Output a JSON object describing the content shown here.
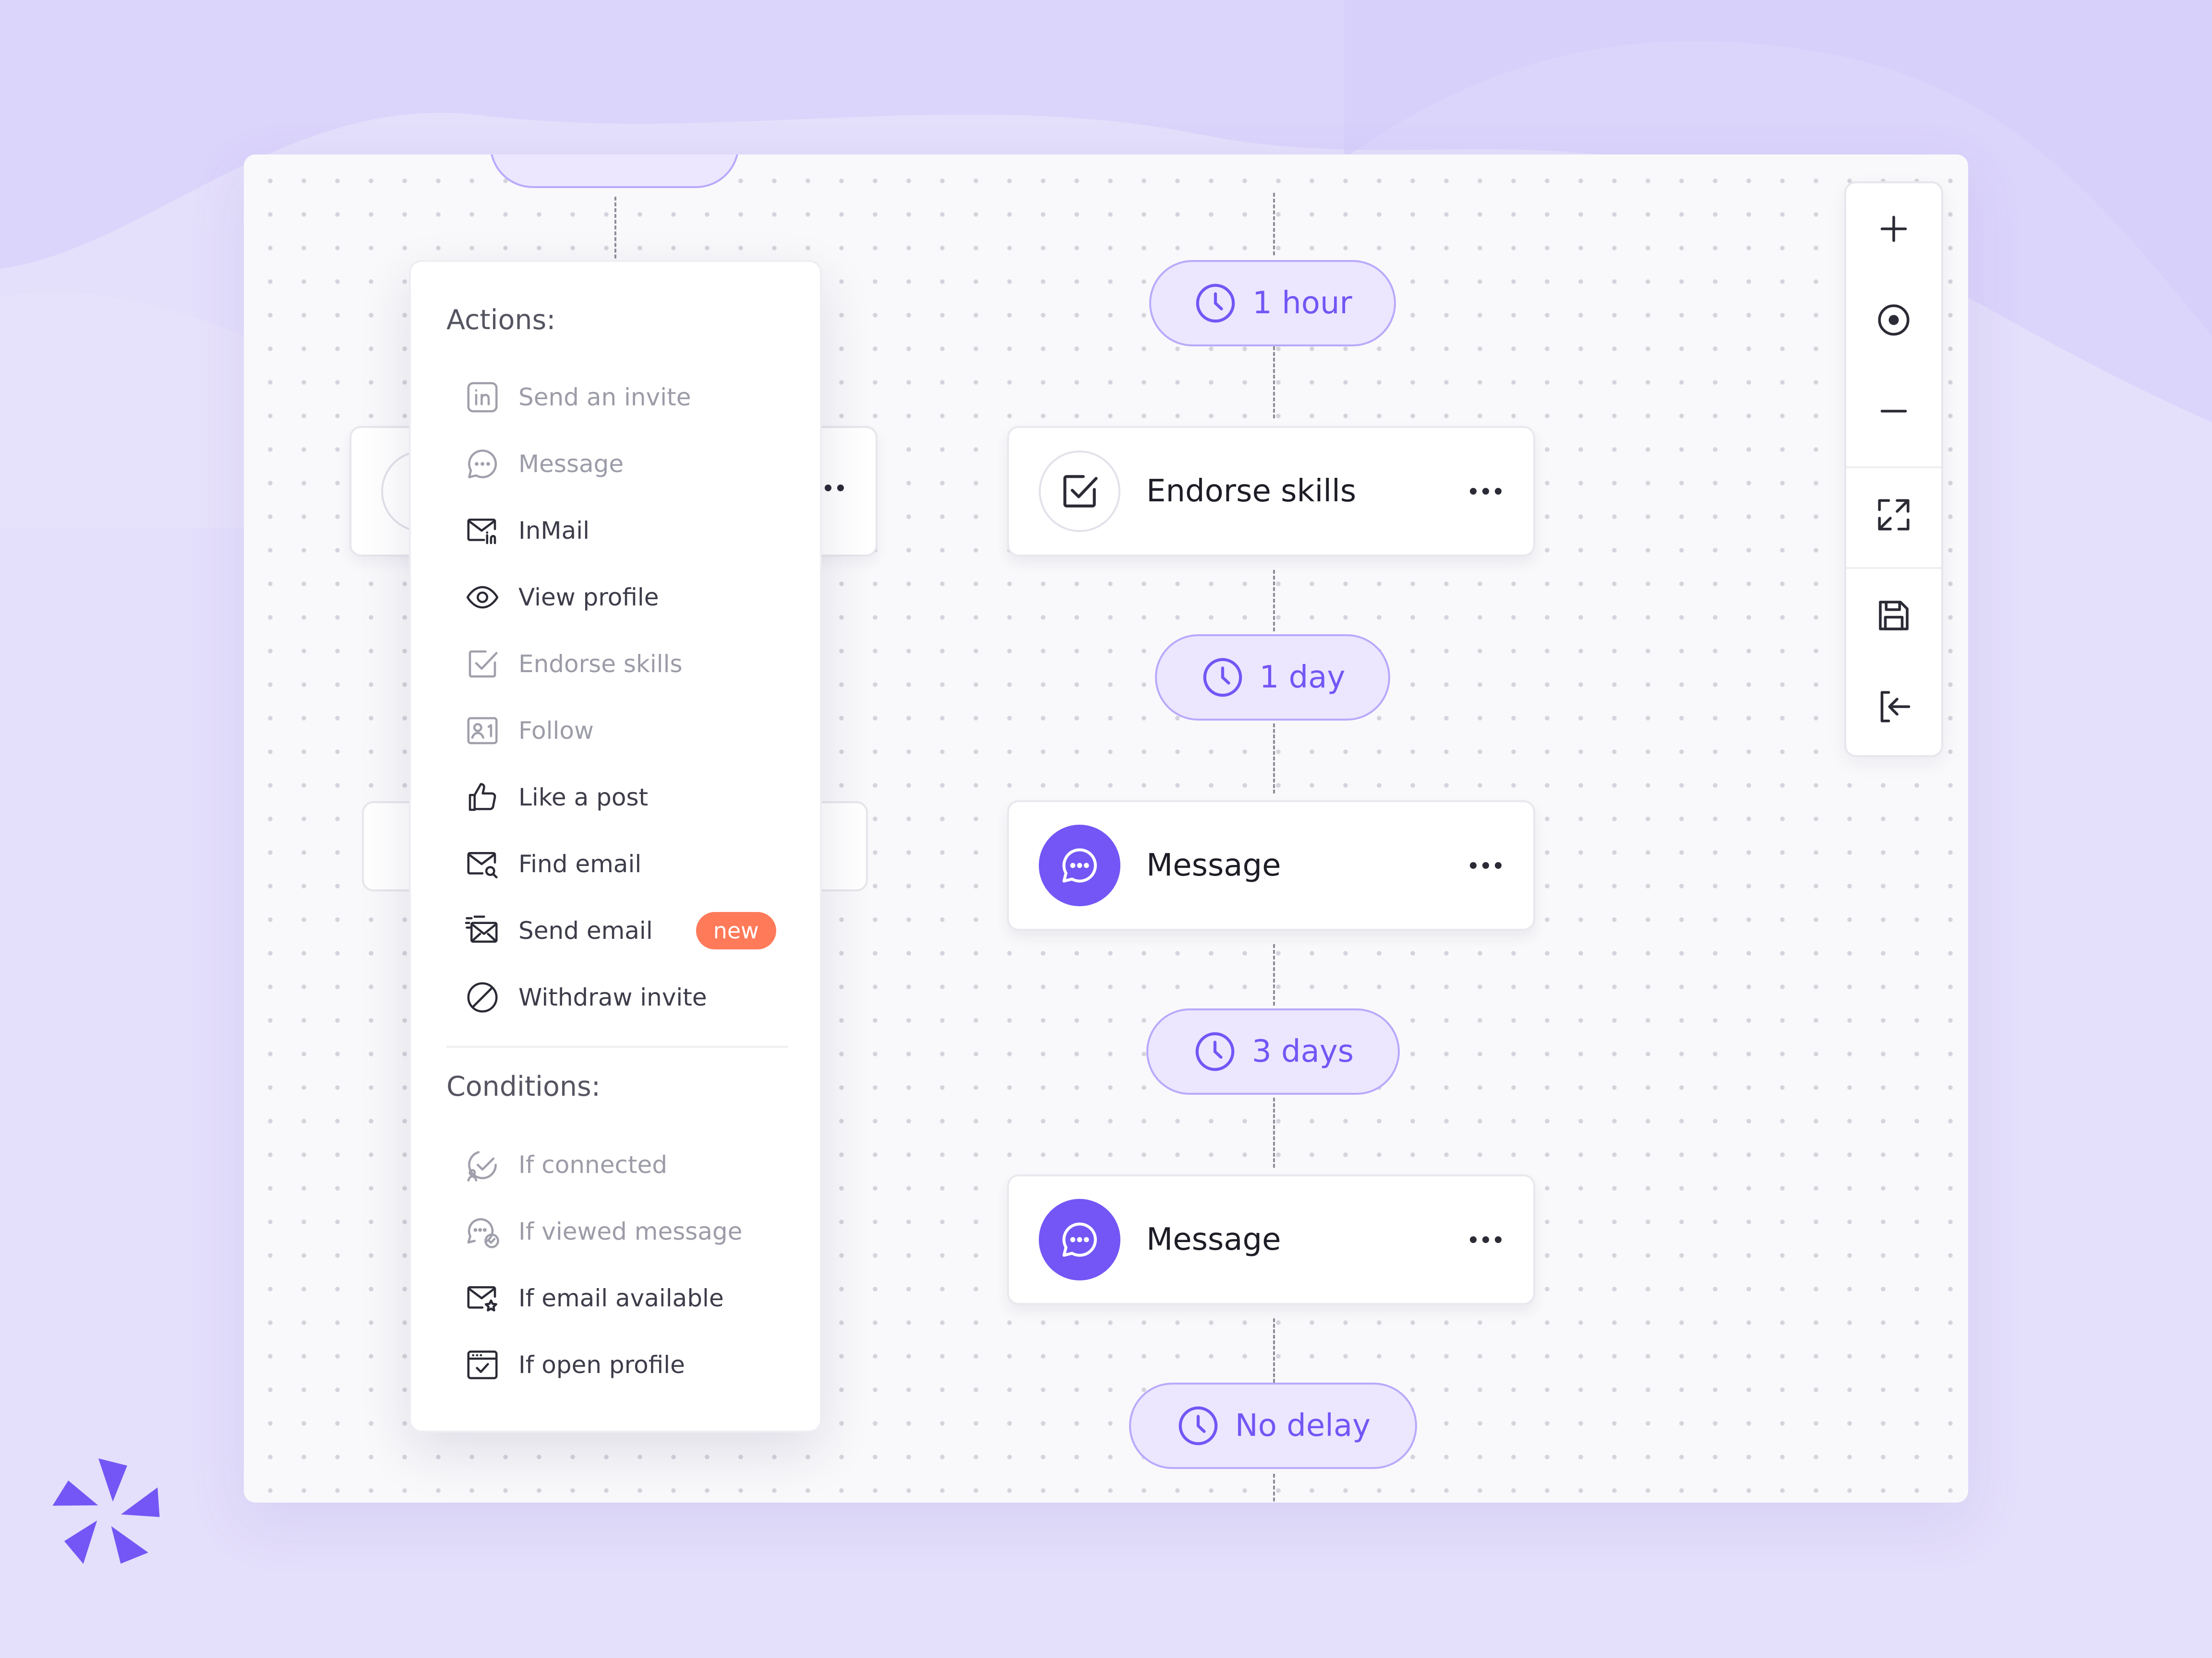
{
  "colors": {
    "accent": "#7356f5",
    "pill_border": "#b9a9fb",
    "pill_bg": "#ece6ff",
    "badge": "#ff7a59",
    "background": "#e4dffb"
  },
  "flow": {
    "delays": [
      {
        "label": "1 hour"
      },
      {
        "label": "1 day"
      },
      {
        "label": "3 days"
      },
      {
        "label": "No delay"
      }
    ],
    "steps": [
      {
        "label": "Endorse skills",
        "icon": "check-square-icon"
      },
      {
        "label": "Message",
        "icon": "chat-bubble-icon"
      },
      {
        "label": "Message",
        "icon": "chat-bubble-icon"
      }
    ]
  },
  "dropdown": {
    "actions_heading": "Actions:",
    "actions": [
      {
        "label": "Send an invite",
        "icon": "linkedin-icon",
        "enabled": false
      },
      {
        "label": "Message",
        "icon": "message-icon",
        "enabled": false
      },
      {
        "label": "InMail",
        "icon": "inmail-icon",
        "enabled": true
      },
      {
        "label": "View profile",
        "icon": "eye-icon",
        "enabled": true
      },
      {
        "label": "Endorse skills",
        "icon": "check-square-icon",
        "enabled": false
      },
      {
        "label": "Follow",
        "icon": "follow-icon",
        "enabled": false
      },
      {
        "label": "Like a post",
        "icon": "thumbs-up-icon",
        "enabled": true
      },
      {
        "label": "Find email",
        "icon": "find-email-icon",
        "enabled": true
      },
      {
        "label": "Send email",
        "icon": "send-email-icon",
        "enabled": true,
        "badge": "new"
      },
      {
        "label": "Withdraw invite",
        "icon": "withdraw-icon",
        "enabled": true
      }
    ],
    "conditions_heading": "Conditions:",
    "conditions": [
      {
        "label": "If connected",
        "icon": "connected-icon",
        "enabled": false
      },
      {
        "label": "If viewed message",
        "icon": "viewed-message-icon",
        "enabled": false
      },
      {
        "label": "If email available",
        "icon": "email-available-icon",
        "enabled": true
      },
      {
        "label": "If open profile",
        "icon": "open-profile-icon",
        "enabled": true
      }
    ]
  },
  "toolbar": {
    "tools": [
      "zoom-in-icon",
      "center-icon",
      "zoom-out-icon",
      "fullscreen-icon",
      "save-icon",
      "exit-icon"
    ]
  }
}
